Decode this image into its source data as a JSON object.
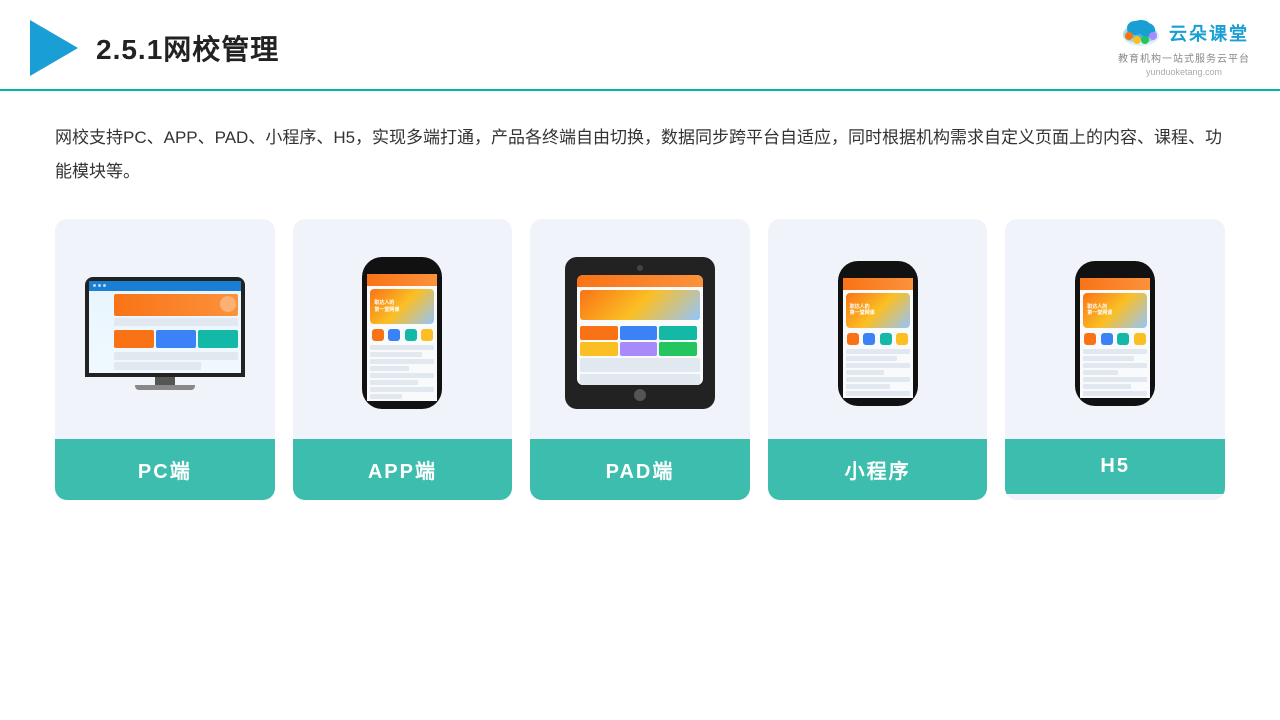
{
  "header": {
    "title": "2.5.1网校管理",
    "logo_name": "云朵课堂",
    "logo_sub": "教育机构一站式服务云平台",
    "logo_url": "yunduoketang.com"
  },
  "description": "网校支持PC、APP、PAD、小程序、H5，实现多端打通，产品各终端自由切换，数据同步跨平台自适应，同时根据机构需求自定义页面上的内容、课程、功能模块等。",
  "cards": [
    {
      "id": "pc",
      "label": "PC端",
      "type": "pc"
    },
    {
      "id": "app",
      "label": "APP端",
      "type": "phone"
    },
    {
      "id": "pad",
      "label": "PAD端",
      "type": "tablet"
    },
    {
      "id": "mini",
      "label": "小程序",
      "type": "phone2"
    },
    {
      "id": "h5",
      "label": "H5",
      "type": "phone3"
    }
  ]
}
